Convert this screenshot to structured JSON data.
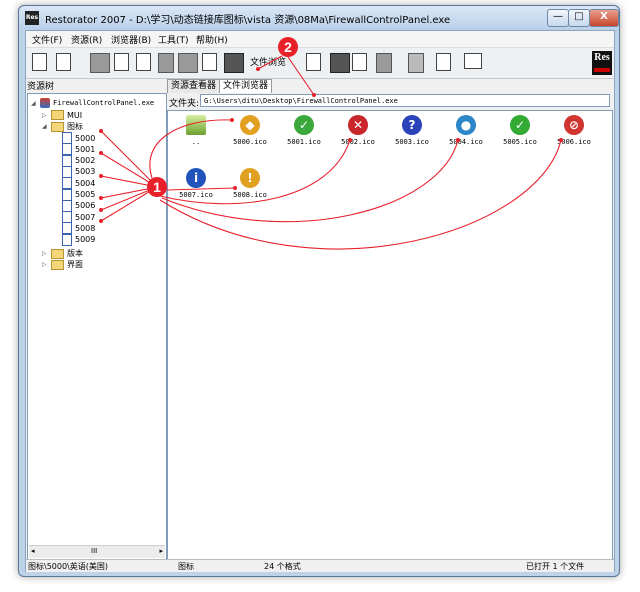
{
  "window": {
    "title": "Restorator 2007 - D:\\学习\\动态链接库图标\\vista 资源\\08Ma\\FirewallControlPanel.exe",
    "app_icon_text": "Res",
    "min": "—",
    "max": "□",
    "close": "X"
  },
  "menu": [
    {
      "label": "文件(F)"
    },
    {
      "label": "资源(R)"
    },
    {
      "label": "浏览器(B)"
    },
    {
      "label": "工具(T)"
    },
    {
      "label": "帮助(H)"
    }
  ],
  "toolbar": {
    "file_browser_label": "文件浏览",
    "logo_text": "Res"
  },
  "left_panel": {
    "header": "资源树",
    "root": "FirewallControlPanel.exe",
    "folders": {
      "mui": "MUI",
      "icons": "图标",
      "version": "版本",
      "ui": "界面"
    },
    "icon_items": [
      "5000",
      "5001",
      "5002",
      "5003",
      "5004",
      "5005",
      "5006",
      "5007",
      "5008",
      "5009"
    ],
    "scroll_grip": "III"
  },
  "tabs": [
    {
      "label": "资源查看器",
      "active": false
    },
    {
      "label": "文件浏览器",
      "active": true
    }
  ],
  "path": {
    "label": "文件夹:",
    "value": "G:\\Users\\ditu\\Desktop\\FirewallControlPanel.exe"
  },
  "files": [
    {
      "name": "..",
      "icon": "up-folder-icon",
      "color": "#8bc34a",
      "glyph": ""
    },
    {
      "name": "5000.ico",
      "icon": "security-shield-icon",
      "color": "#e2a020",
      "glyph": "◆"
    },
    {
      "name": "5001.ico",
      "icon": "shield-check-icon",
      "color": "#3aa83a",
      "glyph": "✓"
    },
    {
      "name": "5002.ico",
      "icon": "shield-x-icon",
      "color": "#c8262a",
      "glyph": "✕"
    },
    {
      "name": "5003.ico",
      "icon": "question-icon",
      "color": "#2b43b8",
      "glyph": "?"
    },
    {
      "name": "5004.ico",
      "icon": "globe-icon",
      "color": "#2c86c8",
      "glyph": "●"
    },
    {
      "name": "5005.ico",
      "icon": "check-icon",
      "color": "#33aa33",
      "glyph": "✓"
    },
    {
      "name": "5006.ico",
      "icon": "no-entry-icon",
      "color": "#d03530",
      "glyph": "⊘"
    },
    {
      "name": "5007.ico",
      "icon": "info-icon",
      "color": "#2255bb",
      "glyph": "i"
    },
    {
      "name": "5008.ico",
      "icon": "warning-shield-icon",
      "color": "#e0a020",
      "glyph": "!"
    }
  ],
  "annotations": {
    "marker1": "1",
    "marker2": "2"
  },
  "status": {
    "path": "图标\\5000\\英语(美国)",
    "category": "图标",
    "format_count": "24 个格式",
    "open_count": "已打开 1 个文件"
  }
}
